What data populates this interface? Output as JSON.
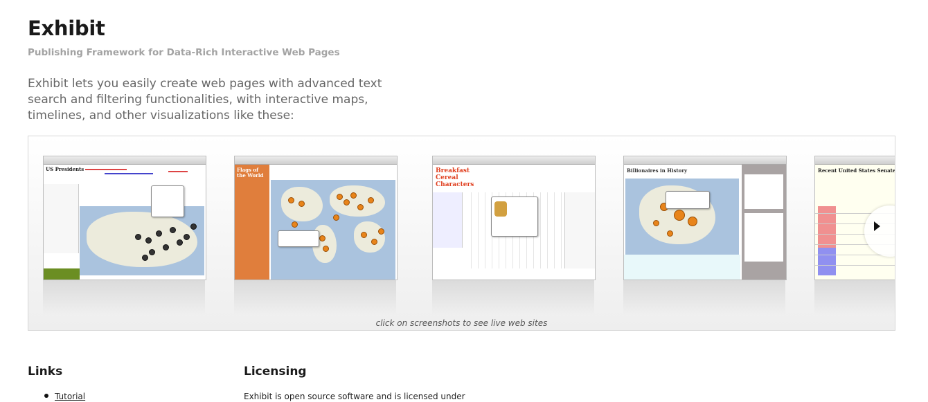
{
  "header": {
    "title": "Exhibit",
    "subtitle": "Publishing Framework for Data-Rich Interactive Web Pages",
    "intro": "Exhibit lets you easily create web pages with advanced text search and filtering functionalities, with interactive maps, timelines, and other visualizations like these:"
  },
  "gallery": {
    "caption": "click on screenshots to see live web sites",
    "shots": [
      {
        "title": "US Presidents"
      },
      {
        "title": "Flags of the World"
      },
      {
        "title": "Breakfast Cereal Characters"
      },
      {
        "title": "Billionaires in History"
      },
      {
        "title": "Recent United States Senate Bills"
      }
    ],
    "next_icon": "chevron-right-icon"
  },
  "links": {
    "heading": "Links",
    "items": [
      {
        "label": "Tutorial"
      }
    ]
  },
  "licensing": {
    "heading": "Licensing",
    "text": "Exhibit is open source software and is licensed under"
  },
  "colors": {
    "title": "#1a1a1a",
    "subtitle": "#a3a3a3",
    "intro": "#666666",
    "flags_sidebar": "#e07e3c",
    "billionaires_sidebar": "#a9a3a3"
  }
}
